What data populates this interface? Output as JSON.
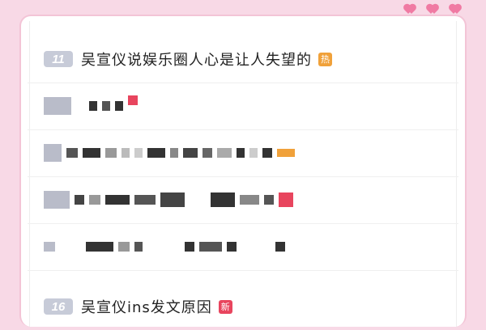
{
  "colors": {
    "background": "#f8d9e6",
    "rank_bg": "#c7cbd8",
    "hot_badge": "#f0a13a",
    "new_badge": "#e8455e",
    "heart": "#f07aa3"
  },
  "list": {
    "item_11": {
      "rank": "11",
      "title": "吴宣仪说娱乐圈人心是让人失望的",
      "badge": "热",
      "badge_color": "#f0a13a"
    },
    "item_16": {
      "rank": "16",
      "title": "吴宣仪ins发文原因",
      "badge": "新",
      "badge_color": "#e8455e"
    }
  }
}
